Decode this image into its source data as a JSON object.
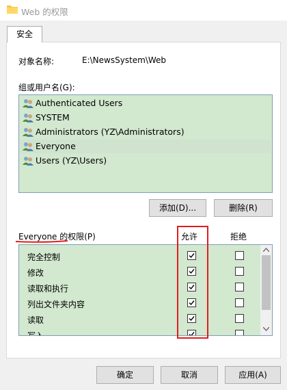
{
  "window": {
    "title": "Web 的权限"
  },
  "tabs": [
    {
      "label": "安全"
    }
  ],
  "object": {
    "label": "对象名称:",
    "value": "E:\\NewsSystem\\Web"
  },
  "groups": {
    "label": "组或用户名(G):",
    "items": [
      {
        "name": "Authenticated Users",
        "selected": false
      },
      {
        "name": "SYSTEM",
        "selected": false
      },
      {
        "name": "Administrators (YZ\\Administrators)",
        "selected": false
      },
      {
        "name": "Everyone",
        "selected": true
      },
      {
        "name": "Users (YZ\\Users)",
        "selected": false
      }
    ]
  },
  "buttons": {
    "add": "添加(D)...",
    "remove": "删除(R)",
    "ok": "确定",
    "cancel": "取消",
    "apply": "应用(A)"
  },
  "permissions": {
    "title": "Everyone 的权限(P)",
    "allow_header": "允许",
    "deny_header": "拒绝",
    "rows": [
      {
        "name": "完全控制",
        "allow": true,
        "deny": false
      },
      {
        "name": "修改",
        "allow": true,
        "deny": false
      },
      {
        "name": "读取和执行",
        "allow": true,
        "deny": false
      },
      {
        "name": "列出文件夹内容",
        "allow": true,
        "deny": false
      },
      {
        "name": "读取",
        "allow": true,
        "deny": false
      },
      {
        "name": "写入",
        "allow": true,
        "deny": false
      }
    ]
  },
  "colors": {
    "highlight": "#d2e8cf",
    "annotation": "#e01c1c"
  }
}
